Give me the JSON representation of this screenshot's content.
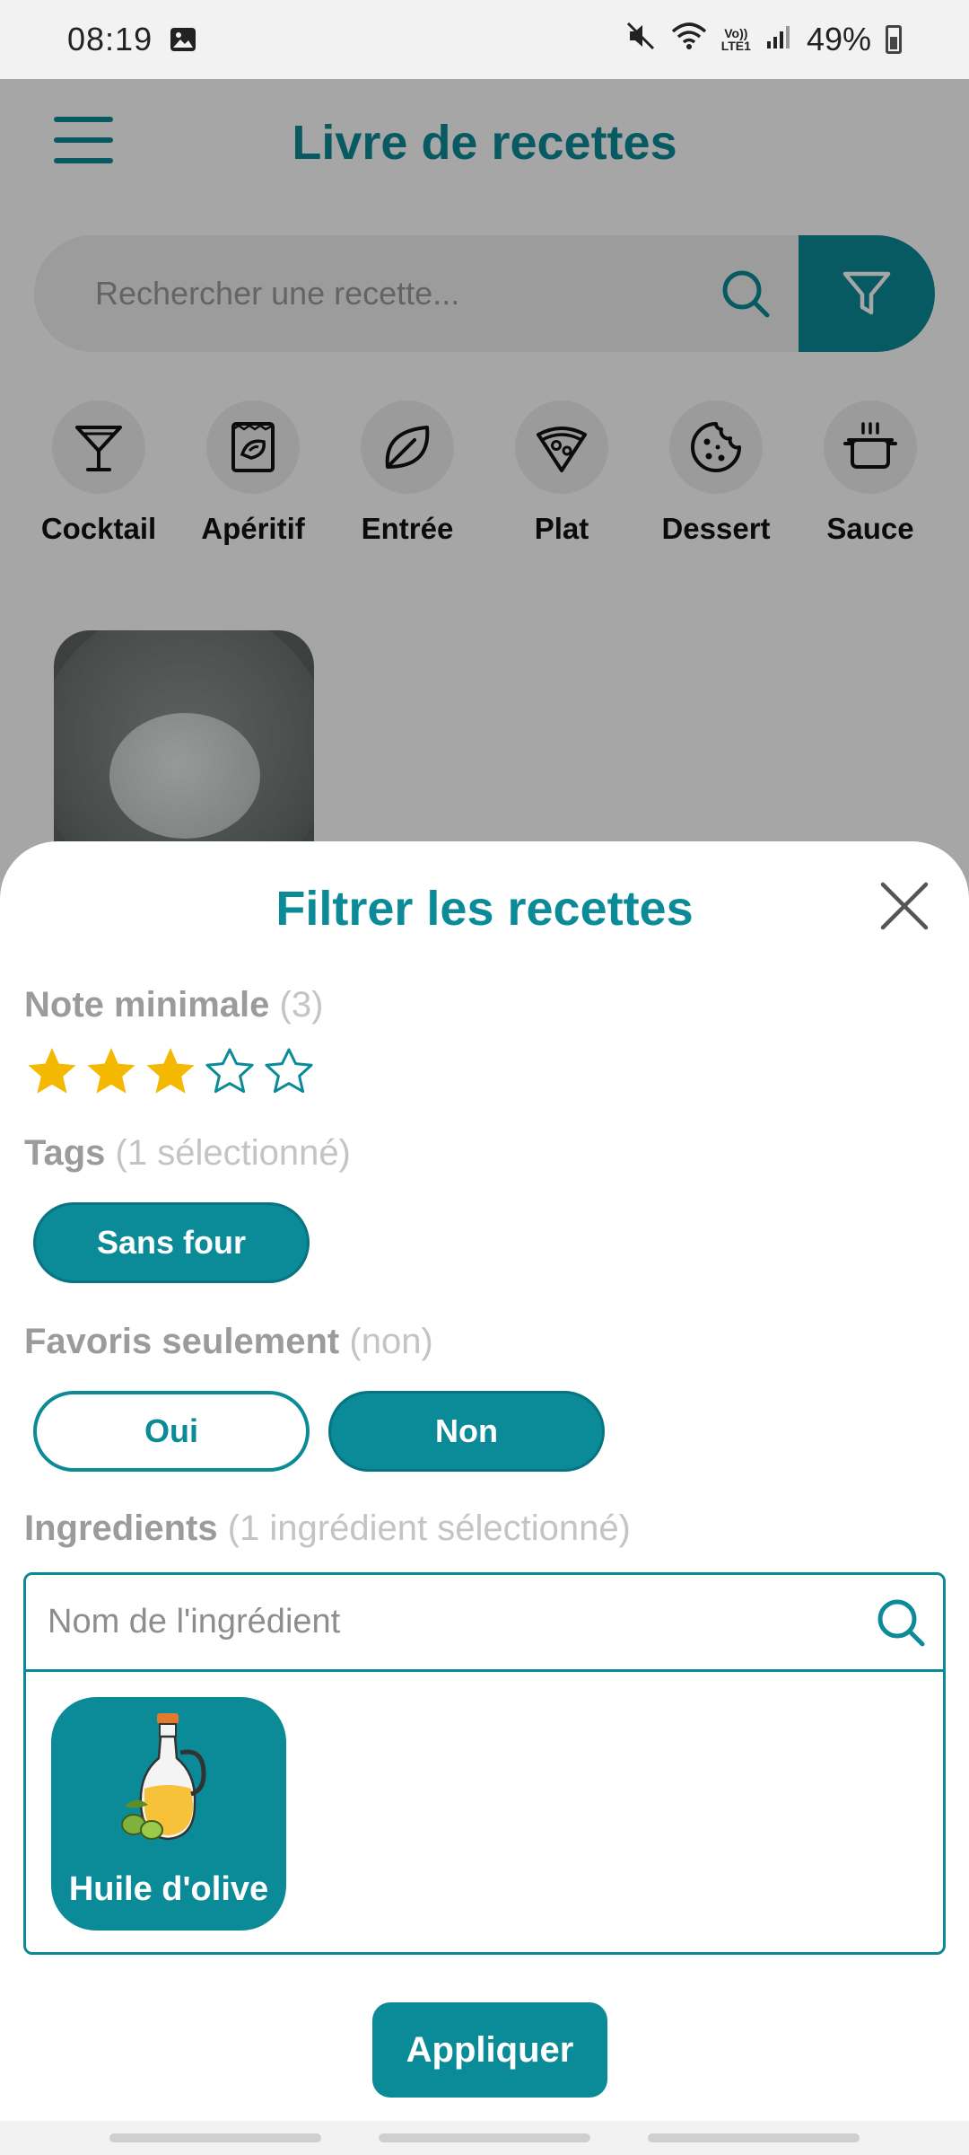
{
  "status_bar": {
    "time": "08:19",
    "lte_top": "Vo))",
    "lte_bottom": "LTE1",
    "battery": "49%"
  },
  "app": {
    "title": "Livre de recettes",
    "search_placeholder": "Rechercher une recette...",
    "categories": [
      {
        "label": "Cocktail",
        "icon": "cocktail-icon"
      },
      {
        "label": "Apéritif",
        "icon": "snack-bag-icon"
      },
      {
        "label": "Entrée",
        "icon": "leaf-icon"
      },
      {
        "label": "Plat",
        "icon": "pizza-icon"
      },
      {
        "label": "Dessert",
        "icon": "cookie-icon"
      },
      {
        "label": "Sauce",
        "icon": "pot-icon"
      }
    ]
  },
  "filter": {
    "title": "Filtrer les recettes",
    "rating": {
      "label": "Note minimale",
      "count": "(3)",
      "value": 3,
      "max": 5
    },
    "tags": {
      "label": "Tags",
      "count": "(1 sélectionné)",
      "selected": [
        "Sans four"
      ]
    },
    "favorites": {
      "label": "Favoris seulement",
      "state": "(non)",
      "yes_label": "Oui",
      "no_label": "Non",
      "selected": "Non"
    },
    "ingredients": {
      "label": "Ingredients",
      "count": "(1 ingrédient sélectionné)",
      "placeholder": "Nom de l'ingrédient",
      "selected": [
        {
          "name": "Huile d'olive",
          "icon": "olive-oil-icon"
        }
      ]
    },
    "apply_label": "Appliquer"
  },
  "colors": {
    "accent": "#0b8a97",
    "star": "#f5b800",
    "muted": "#9b9b9b"
  }
}
